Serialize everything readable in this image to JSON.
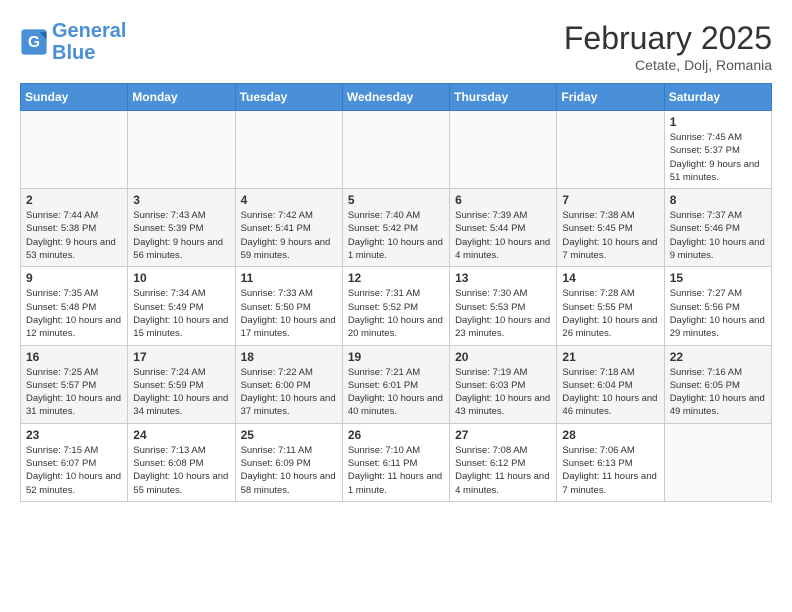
{
  "logo": {
    "text_general": "General",
    "text_blue": "Blue"
  },
  "title": "February 2025",
  "location": "Cetate, Dolj, Romania",
  "days_of_week": [
    "Sunday",
    "Monday",
    "Tuesday",
    "Wednesday",
    "Thursday",
    "Friday",
    "Saturday"
  ],
  "weeks": [
    [
      {
        "day": "",
        "info": ""
      },
      {
        "day": "",
        "info": ""
      },
      {
        "day": "",
        "info": ""
      },
      {
        "day": "",
        "info": ""
      },
      {
        "day": "",
        "info": ""
      },
      {
        "day": "",
        "info": ""
      },
      {
        "day": "1",
        "info": "Sunrise: 7:45 AM\nSunset: 5:37 PM\nDaylight: 9 hours and 51 minutes."
      }
    ],
    [
      {
        "day": "2",
        "info": "Sunrise: 7:44 AM\nSunset: 5:38 PM\nDaylight: 9 hours and 53 minutes."
      },
      {
        "day": "3",
        "info": "Sunrise: 7:43 AM\nSunset: 5:39 PM\nDaylight: 9 hours and 56 minutes."
      },
      {
        "day": "4",
        "info": "Sunrise: 7:42 AM\nSunset: 5:41 PM\nDaylight: 9 hours and 59 minutes."
      },
      {
        "day": "5",
        "info": "Sunrise: 7:40 AM\nSunset: 5:42 PM\nDaylight: 10 hours and 1 minute."
      },
      {
        "day": "6",
        "info": "Sunrise: 7:39 AM\nSunset: 5:44 PM\nDaylight: 10 hours and 4 minutes."
      },
      {
        "day": "7",
        "info": "Sunrise: 7:38 AM\nSunset: 5:45 PM\nDaylight: 10 hours and 7 minutes."
      },
      {
        "day": "8",
        "info": "Sunrise: 7:37 AM\nSunset: 5:46 PM\nDaylight: 10 hours and 9 minutes."
      }
    ],
    [
      {
        "day": "9",
        "info": "Sunrise: 7:35 AM\nSunset: 5:48 PM\nDaylight: 10 hours and 12 minutes."
      },
      {
        "day": "10",
        "info": "Sunrise: 7:34 AM\nSunset: 5:49 PM\nDaylight: 10 hours and 15 minutes."
      },
      {
        "day": "11",
        "info": "Sunrise: 7:33 AM\nSunset: 5:50 PM\nDaylight: 10 hours and 17 minutes."
      },
      {
        "day": "12",
        "info": "Sunrise: 7:31 AM\nSunset: 5:52 PM\nDaylight: 10 hours and 20 minutes."
      },
      {
        "day": "13",
        "info": "Sunrise: 7:30 AM\nSunset: 5:53 PM\nDaylight: 10 hours and 23 minutes."
      },
      {
        "day": "14",
        "info": "Sunrise: 7:28 AM\nSunset: 5:55 PM\nDaylight: 10 hours and 26 minutes."
      },
      {
        "day": "15",
        "info": "Sunrise: 7:27 AM\nSunset: 5:56 PM\nDaylight: 10 hours and 29 minutes."
      }
    ],
    [
      {
        "day": "16",
        "info": "Sunrise: 7:25 AM\nSunset: 5:57 PM\nDaylight: 10 hours and 31 minutes."
      },
      {
        "day": "17",
        "info": "Sunrise: 7:24 AM\nSunset: 5:59 PM\nDaylight: 10 hours and 34 minutes."
      },
      {
        "day": "18",
        "info": "Sunrise: 7:22 AM\nSunset: 6:00 PM\nDaylight: 10 hours and 37 minutes."
      },
      {
        "day": "19",
        "info": "Sunrise: 7:21 AM\nSunset: 6:01 PM\nDaylight: 10 hours and 40 minutes."
      },
      {
        "day": "20",
        "info": "Sunrise: 7:19 AM\nSunset: 6:03 PM\nDaylight: 10 hours and 43 minutes."
      },
      {
        "day": "21",
        "info": "Sunrise: 7:18 AM\nSunset: 6:04 PM\nDaylight: 10 hours and 46 minutes."
      },
      {
        "day": "22",
        "info": "Sunrise: 7:16 AM\nSunset: 6:05 PM\nDaylight: 10 hours and 49 minutes."
      }
    ],
    [
      {
        "day": "23",
        "info": "Sunrise: 7:15 AM\nSunset: 6:07 PM\nDaylight: 10 hours and 52 minutes."
      },
      {
        "day": "24",
        "info": "Sunrise: 7:13 AM\nSunset: 6:08 PM\nDaylight: 10 hours and 55 minutes."
      },
      {
        "day": "25",
        "info": "Sunrise: 7:11 AM\nSunset: 6:09 PM\nDaylight: 10 hours and 58 minutes."
      },
      {
        "day": "26",
        "info": "Sunrise: 7:10 AM\nSunset: 6:11 PM\nDaylight: 11 hours and 1 minute."
      },
      {
        "day": "27",
        "info": "Sunrise: 7:08 AM\nSunset: 6:12 PM\nDaylight: 11 hours and 4 minutes."
      },
      {
        "day": "28",
        "info": "Sunrise: 7:06 AM\nSunset: 6:13 PM\nDaylight: 11 hours and 7 minutes."
      },
      {
        "day": "",
        "info": ""
      }
    ]
  ]
}
